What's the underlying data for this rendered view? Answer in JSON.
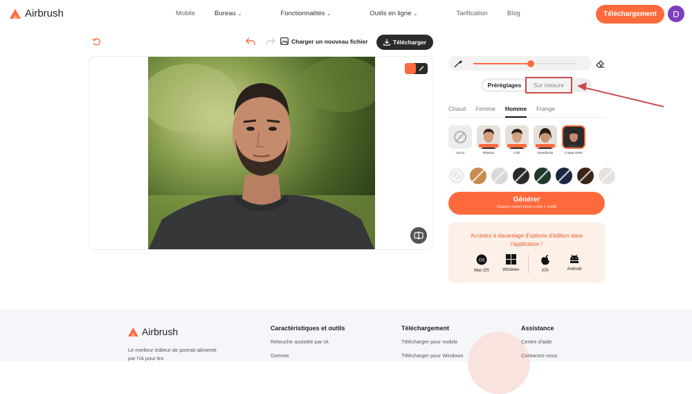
{
  "header": {
    "brand": "Airbrush",
    "nav": [
      {
        "label": "Mobile",
        "dropdown": false
      },
      {
        "label": "Bureau",
        "dropdown": true
      },
      {
        "label": "Fonctionnalités",
        "dropdown": true
      },
      {
        "label": "Outils en ligne",
        "dropdown": true
      },
      {
        "label": "Tarification",
        "dropdown": false
      },
      {
        "label": "Blog",
        "dropdown": false
      }
    ],
    "cta_label": "Téléchargement",
    "avatar_letter": "D",
    "accent": "#ff6a3d"
  },
  "toolbar": {
    "upload_label": "Charger un nouveau fichier",
    "download_label": "Télécharger"
  },
  "panel": {
    "brush_size_fraction": 0.55,
    "segment": {
      "presets": "Préréglages",
      "custom": "Sur mesure"
    },
    "tabs": [
      {
        "label": "Chaud",
        "active": false
      },
      {
        "label": "Femme",
        "active": false
      },
      {
        "label": "Homme",
        "active": true
      },
      {
        "label": "Frange",
        "active": false
      }
    ],
    "styles": [
      {
        "label": "Aucun",
        "none": true
      },
      {
        "label": "Rideaux"
      },
      {
        "label": "Côté"
      },
      {
        "label": "Dreadlocks"
      },
      {
        "label": "Coupe rasée",
        "selected": true
      }
    ],
    "swatch_colors": [
      "#e9e9e9",
      "#c98b4d",
      "#d8d8d8",
      "#2a2a2a",
      "#1f3a2a",
      "#1c2740",
      "#3a2418",
      "#e6e1de"
    ],
    "generate_label": "Générer",
    "generate_sub": "Chaque export photo coûte 1 crédit",
    "promo_text": "Accédez à davantage d'options d'édition dans l'application !",
    "platforms": [
      {
        "label": "Mac OS",
        "icon": "macos-icon"
      },
      {
        "label": "Windows",
        "icon": "windows-icon"
      },
      {
        "label": "iOS",
        "icon": "apple-icon"
      },
      {
        "label": "Android",
        "icon": "android-icon"
      }
    ]
  },
  "footer": {
    "brand": "Airbrush",
    "desc": "Le meilleur éditeur de portrait alimenté par l'IA pour les",
    "col1": {
      "title": "Caractéristiques et outils",
      "links": [
        "Retouche assistée par IA",
        "Gomme"
      ]
    },
    "col2": {
      "title": "Téléchargement",
      "links": [
        "Télécharger pour mobile",
        "Télécharger pour Windows"
      ]
    },
    "col3": {
      "title": "Assistance",
      "links": [
        "Centre d'aide",
        "Contactez-nous"
      ]
    }
  }
}
